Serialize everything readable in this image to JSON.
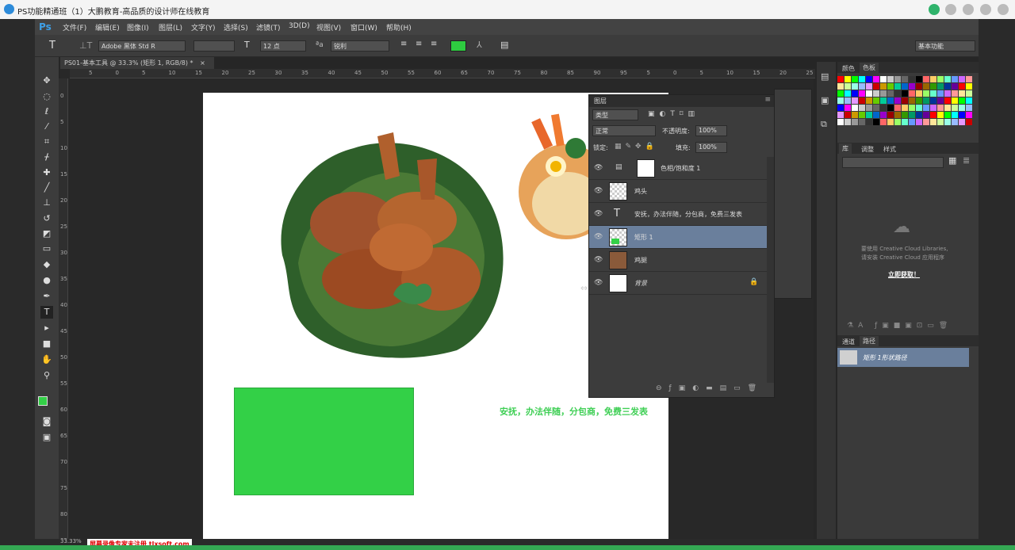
{
  "window": {
    "title": "PS功能精通班（1）大鹏教育-高品质的设计师在线教育"
  },
  "app": {
    "logo": "Ps"
  },
  "menu": [
    {
      "label": "文件(F)"
    },
    {
      "label": "编辑(E)"
    },
    {
      "label": "图像(I)"
    },
    {
      "label": "图层(L)"
    },
    {
      "label": "文字(Y)"
    },
    {
      "label": "选择(S)"
    },
    {
      "label": "滤镜(T)"
    },
    {
      "label": "3D(D)"
    },
    {
      "label": "视图(V)"
    },
    {
      "label": "窗口(W)"
    },
    {
      "label": "帮助(H)"
    }
  ],
  "options": {
    "font_family": "Adobe 黑体 Std R",
    "font_size": "12 点",
    "aa_label": "a",
    "antialias": "锐利",
    "text_color": "#2ecc40",
    "workspace": "基本功能"
  },
  "document": {
    "tab_label": "PS01-基本工具 @ 33.3% (矩形 1, RGB/8) *",
    "zoom": "33.33%",
    "ruler_h": [
      "5",
      "0",
      "5",
      "10",
      "15",
      "20",
      "25",
      "30",
      "35",
      "40",
      "45",
      "50",
      "55",
      "60",
      "65",
      "70",
      "75",
      "80",
      "85",
      "90",
      "95",
      "5",
      "0",
      "5",
      "10",
      "15",
      "20",
      "25"
    ],
    "ruler_v": [
      "0",
      "5",
      "10",
      "15",
      "20",
      "25",
      "30",
      "35",
      "40",
      "45",
      "50",
      "55",
      "60",
      "65",
      "70",
      "75",
      "80",
      "85"
    ],
    "canvas_text": "安抚，办法伴随，分包商，免费三发表",
    "rect_color": "#33d047"
  },
  "layers_panel": {
    "title": "图层",
    "filter": "类型",
    "blend_mode": "正常",
    "opacity_label": "不透明度:",
    "opacity": "100%",
    "lock_label": "锁定:",
    "fill_label": "填充:",
    "fill": "100%",
    "layers": [
      {
        "name": "色相/饱和度 1",
        "selected": false
      },
      {
        "name": "鸡头",
        "selected": false
      },
      {
        "name": "安抚，办法伴随，分包商，免费三发表",
        "selected": false
      },
      {
        "name": "矩形 1",
        "selected": true
      },
      {
        "name": "鸡腿",
        "selected": false
      },
      {
        "name": "背景",
        "selected": false
      }
    ]
  },
  "right_panels": {
    "tab_color_1": "颜色",
    "tab_color_2": "色板",
    "tab_lib": "库",
    "tab_adjust": "调整",
    "tab_style": "样式",
    "cc_msg_1": "要使用 Creative Cloud Libraries,",
    "cc_msg_2": "请安装 Creative Cloud 应用程序",
    "cc_link": "立即获取！",
    "tab_channels": "通道",
    "tab_paths": "路径",
    "path_item": "矩形 1形状路径"
  },
  "status": {
    "watermark": "屏幕录像专家未注册 tlxsoft.com"
  }
}
